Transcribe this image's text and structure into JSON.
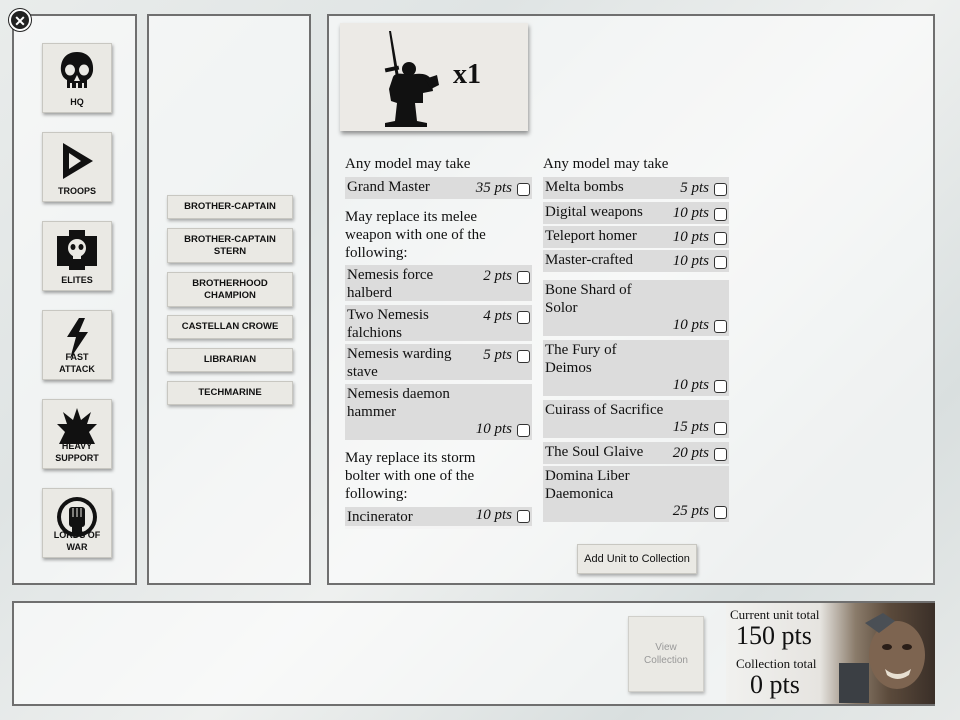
{
  "categories": [
    {
      "label": "HQ",
      "icon": "skull-icon"
    },
    {
      "label": "TROOPS",
      "icon": "chevron-triangle-icon"
    },
    {
      "label": "ELITES",
      "icon": "skull-cross-icon"
    },
    {
      "label": "FAST ATTACK",
      "icon": "lightning-icon"
    },
    {
      "label": "HEAVY SUPPORT",
      "icon": "explosion-icon"
    },
    {
      "label": "LORDS OF WAR",
      "icon": "fist-icon"
    }
  ],
  "units": [
    "BROTHER-CAPTAIN",
    "BROTHER-CAPTAIN STERN",
    "BROTHERHOOD CHAMPION",
    "CASTELLAN CROWE",
    "LIBRARIAN",
    "TECHMARINE"
  ],
  "unit_card": {
    "count": "x1",
    "icon": "space-marine-silhouette-icon"
  },
  "left_options": {
    "group1_heading": "Any model may take",
    "group1": [
      {
        "name": "Grand Master",
        "pts": "35 pts"
      }
    ],
    "group2_heading": "May replace its melee weapon with one of the following:",
    "group2": [
      {
        "name": "Nemesis force halberd",
        "pts": "2 pts"
      },
      {
        "name": "Two Nemesis falchions",
        "pts": "4 pts"
      },
      {
        "name": "Nemesis warding stave",
        "pts": "5 pts"
      },
      {
        "name": "Nemesis daemon hammer",
        "pts": "10 pts"
      }
    ],
    "group3_heading": "May replace its storm bolter with one of the following:",
    "group3": [
      {
        "name": "Incinerator",
        "pts": "10 pts"
      }
    ]
  },
  "right_options": {
    "heading": "Any model may take",
    "items": [
      {
        "name": "Melta bombs",
        "pts": "5 pts"
      },
      {
        "name": "Digital weapons",
        "pts": "10 pts"
      },
      {
        "name": "Teleport homer",
        "pts": "10 pts"
      },
      {
        "name": "Master-crafted",
        "pts": "10 pts"
      },
      {
        "name": "Bone Shard of Solor",
        "pts": "10 pts"
      },
      {
        "name": "The Fury of Deimos",
        "pts": "10 pts"
      },
      {
        "name": "Cuirass of Sacrifice",
        "pts": "15 pts"
      },
      {
        "name": "The Soul Glaive",
        "pts": "20 pts"
      },
      {
        "name": "Domina Liber Daemonica",
        "pts": "25 pts"
      }
    ]
  },
  "add_unit_label": "Add Unit to Collection",
  "footer": {
    "view_collection": "View Collection",
    "current_unit_label": "Current unit total",
    "current_unit_value": "150 pts",
    "collection_label": "Collection total",
    "collection_value": "0 pts"
  },
  "colors": {
    "border": "#6f6f6f",
    "button": "#eae9e4",
    "option_bg": "#dcdcdc"
  }
}
